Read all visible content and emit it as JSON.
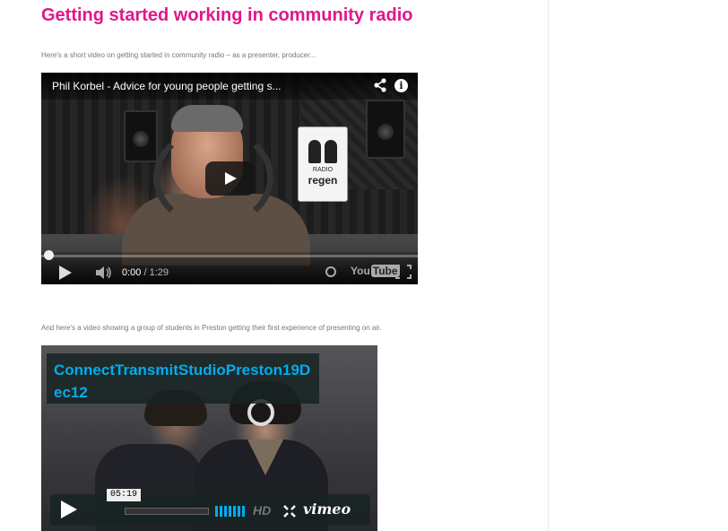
{
  "post": {
    "title": "Getting started working in community radio",
    "intro": "Here's a short video on getting started in community radio – as a presenter, producer...",
    "second_intro": "And here's a video showing a group of students in Preston getting their first experience of presenting on air."
  },
  "youtube_player": {
    "title": "Phil Korbel - Advice for young people getting s...",
    "current_time": "0:00",
    "duration": "/ 1:29",
    "logo_you": "You",
    "logo_tube": "Tube",
    "sign_text_top": "RADIO",
    "sign_text_bottom": "regen",
    "progress": 0
  },
  "vimeo_player": {
    "title": "ConnectTransmitStudioPreston19Dec12",
    "time_tooltip": "05:19",
    "hd_label": "HD",
    "logo": "vimeo",
    "progress": 0
  },
  "colors": {
    "title": "#e2168b",
    "vimeo_accent": "#00adef"
  }
}
